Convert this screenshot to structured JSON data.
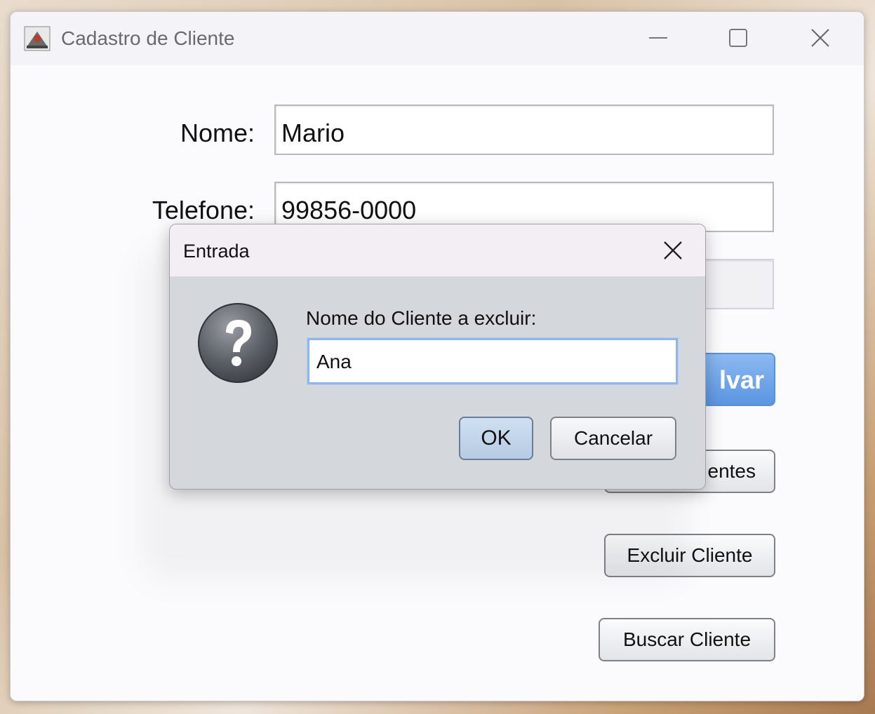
{
  "window": {
    "title": "Cadastro de Cliente",
    "controls": {
      "minimize_icon": "minimize-icon",
      "maximize_icon": "maximize-icon",
      "close_icon": "close-icon"
    }
  },
  "form": {
    "nome_label": "Nome:",
    "nome_value": "Mario",
    "telefone_label": "Telefone:",
    "telefone_value": "99856-0000"
  },
  "buttons": {
    "salvar_visible": "lvar",
    "listar_visible": "entes",
    "excluir": "Excluir Cliente",
    "buscar": "Buscar Cliente"
  },
  "dialog": {
    "title": "Entrada",
    "prompt": "Nome do Cliente a excluir:",
    "input_value": "Ana",
    "ok": "OK",
    "cancel": "Cancelar",
    "icon": "question-icon"
  },
  "colors": {
    "primary_button": "#5b95e0",
    "focus_border": "#8eb6e6",
    "dialog_bg": "#d4d8dd"
  }
}
